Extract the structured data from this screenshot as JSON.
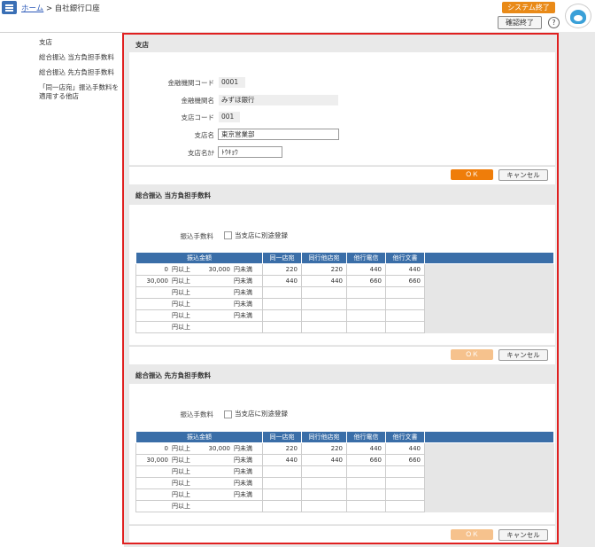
{
  "header": {
    "home_link": "ホーム",
    "separator": ">",
    "current": "自社銀行口座",
    "system_end": "システム終了",
    "confirm_end": "確認終了",
    "help": "?"
  },
  "sidebar": {
    "items": [
      {
        "label": "支店"
      },
      {
        "label": "総合振込 当方負担手数料"
      },
      {
        "label": "総合振込 先方負担手数料"
      },
      {
        "label": "「同一店宛」振込手数料を適用する他店"
      }
    ]
  },
  "branch": {
    "title": "支店",
    "bank_code_label": "金融機関コード",
    "bank_code": "0001",
    "bank_name_label": "金融機関名",
    "bank_name": "みずほ銀行",
    "branch_code_label": "支店コード",
    "branch_code": "001",
    "branch_name_label": "支店名",
    "branch_name": "東京営業部",
    "branch_kana_label": "支店名ｶﾅ",
    "branch_kana": "ﾄｳｷｮｳ",
    "ok": "ＯＫ",
    "cancel": "キャンセル"
  },
  "fee_own": {
    "title": "総合振込 当方負担手数料",
    "fee_label": "振込手数料",
    "check_label": "当支店に別途登録",
    "headers": [
      "振込金額",
      "同一店宛",
      "同行他店宛",
      "他行電信",
      "他行文書"
    ],
    "rows": [
      {
        "from": "0",
        "ijo": "円以上",
        "to": "30,000",
        "miman": "円未満",
        "v": [
          "220",
          "220",
          "440",
          "440"
        ]
      },
      {
        "from": "30,000",
        "ijo": "円以上",
        "to": "",
        "miman": "円未満",
        "v": [
          "440",
          "440",
          "660",
          "660"
        ]
      },
      {
        "from": "",
        "ijo": "円以上",
        "to": "",
        "miman": "円未満",
        "v": [
          "",
          "",
          "",
          ""
        ]
      },
      {
        "from": "",
        "ijo": "円以上",
        "to": "",
        "miman": "円未満",
        "v": [
          "",
          "",
          "",
          ""
        ]
      },
      {
        "from": "",
        "ijo": "円以上",
        "to": "",
        "miman": "円未満",
        "v": [
          "",
          "",
          "",
          ""
        ]
      },
      {
        "from": "",
        "ijo": "円以上",
        "to": "",
        "miman": "",
        "v": [
          "",
          "",
          "",
          ""
        ]
      }
    ],
    "ok": "ＯＫ",
    "cancel": "キャンセル"
  },
  "fee_other": {
    "title": "総合振込 先方負担手数料",
    "fee_label": "振込手数料",
    "check_label": "当支店に別途登録",
    "headers": [
      "振込金額",
      "同一店宛",
      "同行他店宛",
      "他行電信",
      "他行文書"
    ],
    "rows": [
      {
        "from": "0",
        "ijo": "円以上",
        "to": "30,000",
        "miman": "円未満",
        "v": [
          "220",
          "220",
          "440",
          "440"
        ]
      },
      {
        "from": "30,000",
        "ijo": "円以上",
        "to": "",
        "miman": "円未満",
        "v": [
          "440",
          "440",
          "660",
          "660"
        ]
      },
      {
        "from": "",
        "ijo": "円以上",
        "to": "",
        "miman": "円未満",
        "v": [
          "",
          "",
          "",
          ""
        ]
      },
      {
        "from": "",
        "ijo": "円以上",
        "to": "",
        "miman": "円未満",
        "v": [
          "",
          "",
          "",
          ""
        ]
      },
      {
        "from": "",
        "ijo": "円以上",
        "to": "",
        "miman": "円未満",
        "v": [
          "",
          "",
          "",
          ""
        ]
      },
      {
        "from": "",
        "ijo": "円以上",
        "to": "",
        "miman": "",
        "v": [
          "",
          "",
          "",
          ""
        ]
      }
    ],
    "ok": "ＯＫ",
    "cancel": "キャンセル"
  }
}
